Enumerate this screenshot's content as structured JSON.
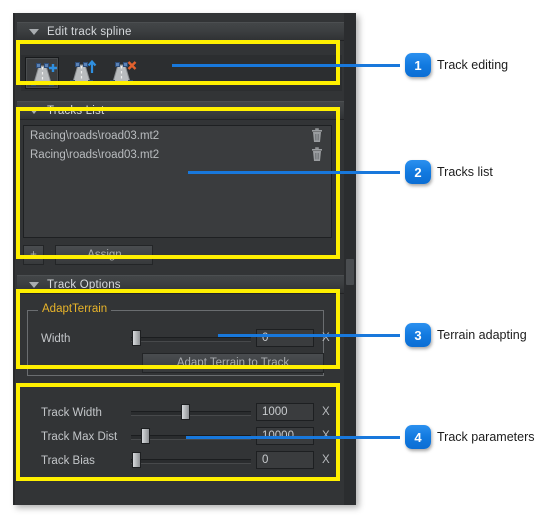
{
  "sections": {
    "edit_track_spline": {
      "title": "Edit track spline"
    },
    "tracks_list": {
      "title": "Tracks List"
    },
    "track_options": {
      "title": "Track Options"
    }
  },
  "toolbar": {
    "tools": [
      {
        "name": "add-track-spline",
        "icon": "road-plus-icon",
        "selected": true
      },
      {
        "name": "move-track-spline",
        "icon": "road-arrow-up-icon",
        "selected": false
      },
      {
        "name": "delete-track-spline",
        "icon": "road-x-icon",
        "selected": false
      }
    ]
  },
  "tracks_list": {
    "items": [
      {
        "path": "Racing\\roads\\road03.mt2",
        "delete_icon": "trash-icon"
      },
      {
        "path": "Racing\\roads\\road03.mt2",
        "delete_icon": "trash-icon"
      }
    ],
    "add_label": "+",
    "assign_label": "Assign"
  },
  "adapt_terrain": {
    "group_title": "AdaptTerrain",
    "width_label": "Width",
    "width_value": "0",
    "width_percent": 1,
    "width_unit": "X",
    "button_label": "Adapt Terrain to Track"
  },
  "track_parameters": {
    "rows": [
      {
        "label": "Track Width",
        "value": "1000",
        "percent": 45,
        "unit": "X"
      },
      {
        "label": "Track Max Dist",
        "value": "10000",
        "percent": 9,
        "unit": "X"
      },
      {
        "label": "Track Bias",
        "value": "0",
        "percent": 1,
        "unit": "X"
      }
    ]
  },
  "callouts": [
    {
      "number": "1",
      "label": "Track editing"
    },
    {
      "number": "2",
      "label": "Tracks list"
    },
    {
      "number": "3",
      "label": "Terrain adapting"
    },
    {
      "number": "4",
      "label": "Track parameters"
    }
  ],
  "colors": {
    "highlight": "#fff000",
    "leader": "#1878dc",
    "badge": "#127ae0",
    "panel_bg": "#323436",
    "group_legend": "#e8b42a"
  }
}
